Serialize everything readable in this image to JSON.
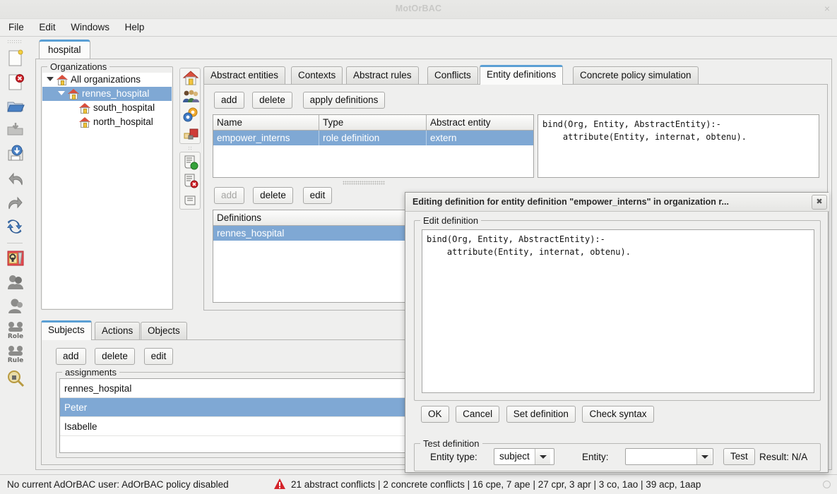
{
  "window": {
    "title": "MotOrBAC",
    "close_label": "×"
  },
  "menu": {
    "items": [
      {
        "label": "File"
      },
      {
        "label": "Edit"
      },
      {
        "label": "Windows"
      },
      {
        "label": "Help"
      }
    ]
  },
  "left_toolbar": {
    "items": [
      {
        "name": "new-policy-icon",
        "tooltip": "new"
      },
      {
        "name": "close-policy-icon",
        "tooltip": "close"
      },
      {
        "name": "open-folder-icon",
        "tooltip": "open"
      },
      {
        "name": "save-icon",
        "tooltip": "save"
      },
      {
        "name": "save-as-icon",
        "tooltip": "save as"
      },
      {
        "name": "undo-icon",
        "tooltip": "undo"
      },
      {
        "name": "redo-icon",
        "tooltip": "redo"
      },
      {
        "name": "refresh-icon",
        "tooltip": "refresh"
      },
      {
        "name": "security-lock-icon",
        "tooltip": "security"
      },
      {
        "name": "group-dark-icon",
        "tooltip": "groups"
      },
      {
        "name": "group-dark2-icon",
        "tooltip": "groups 2"
      },
      {
        "name": "role-icon",
        "tooltip": "Role",
        "caption": "Role"
      },
      {
        "name": "rule-icon",
        "tooltip": "Rule",
        "caption": "Rule"
      },
      {
        "name": "search-lock-icon",
        "tooltip": "inspect"
      }
    ]
  },
  "outer_tab": {
    "label": "hospital"
  },
  "organizations": {
    "group_label": "Organizations",
    "tree": [
      {
        "label": "All organizations",
        "depth": 0,
        "expanded": true,
        "selected": false
      },
      {
        "label": "rennes_hospital",
        "depth": 1,
        "expanded": true,
        "selected": true
      },
      {
        "label": "south_hospital",
        "depth": 2,
        "expanded": false,
        "selected": false
      },
      {
        "label": "north_hospital",
        "depth": 2,
        "expanded": false,
        "selected": false
      }
    ]
  },
  "rail": {
    "top_icons": [
      {
        "name": "organization-home-icon"
      },
      {
        "name": "users-group-icon"
      },
      {
        "name": "gears-settings-icon"
      },
      {
        "name": "objects-icon"
      }
    ],
    "bottom_icons": [
      {
        "name": "rule-permission-icon"
      },
      {
        "name": "rule-prohibition-icon"
      },
      {
        "name": "rule-plain-icon"
      }
    ]
  },
  "main_tabs": {
    "items": [
      {
        "label": "Abstract entities",
        "active": false
      },
      {
        "label": "Contexts",
        "active": false
      },
      {
        "label": "Abstract rules",
        "active": false
      },
      {
        "label": "Conflicts",
        "active": false
      },
      {
        "label": "Entity definitions",
        "active": true
      },
      {
        "label": "Concrete policy simulation",
        "active": false
      }
    ]
  },
  "entity_definitions": {
    "toolbar": [
      {
        "label": "add",
        "disabled": false
      },
      {
        "label": "delete",
        "disabled": false
      },
      {
        "label": "apply definitions",
        "disabled": false
      }
    ],
    "table": {
      "columns": [
        "Name",
        "Type",
        "Abstract entity"
      ],
      "rows": [
        {
          "cells": [
            "empower_interns",
            "role definition",
            "extern"
          ],
          "selected": true
        }
      ]
    },
    "code": "bind(Org, Entity, AbstractEntity):-\n    attribute(Entity, internat, obtenu).",
    "definitions_toolbar": [
      {
        "label": "add",
        "disabled": true
      },
      {
        "label": "delete",
        "disabled": false
      },
      {
        "label": "edit",
        "disabled": false
      }
    ],
    "definitions_table": {
      "columns": [
        "Definitions"
      ],
      "rows": [
        {
          "cells": [
            "rennes_hospital"
          ],
          "selected": true
        }
      ]
    }
  },
  "bottom_tabs": {
    "items": [
      {
        "label": "Subjects",
        "active": true
      },
      {
        "label": "Actions",
        "active": false
      },
      {
        "label": "Objects",
        "active": false
      }
    ],
    "toolbar": [
      {
        "label": "add",
        "disabled": false
      },
      {
        "label": "delete",
        "disabled": false
      },
      {
        "label": "edit",
        "disabled": false
      }
    ],
    "assignments": {
      "group_label": "assignments",
      "rows": [
        {
          "label": "rennes_hospital",
          "selected": false
        },
        {
          "label": "Peter",
          "selected": true
        },
        {
          "label": "Isabelle",
          "selected": false
        }
      ]
    }
  },
  "dialog": {
    "title": "Editing definition for entity definition \"empower_interns\" in organization r...",
    "close_label": "✖",
    "edit_group_label": "Edit definition",
    "code": "bind(Org, Entity, AbstractEntity):-\n    attribute(Entity, internat, obtenu).",
    "buttons": [
      {
        "label": "OK"
      },
      {
        "label": "Cancel"
      },
      {
        "label": "Set definition"
      },
      {
        "label": "Check syntax"
      }
    ],
    "test_group_label": "Test definition",
    "entity_type_label": "Entity type:",
    "entity_type_value": "subject",
    "entity_label": "Entity:",
    "entity_value": "",
    "test_button_label": "Test",
    "result_label": "Result: N/A"
  },
  "statusbar": {
    "user_text": "No current AdOrBAC user: AdOrBAC policy disabled",
    "warning_icon": "warning-triangle-icon",
    "counts": "21 abstract conflicts | 2 concrete conflicts | 16 cpe, 7 ape | 27 cpr, 3 apr | 3 co, 1ao | 39 acp, 1aap"
  },
  "colors": {
    "selection": "#7fa8d4",
    "accent_tab": "#5a9fd4",
    "warning": "#d4232a",
    "background": "#efefee"
  }
}
